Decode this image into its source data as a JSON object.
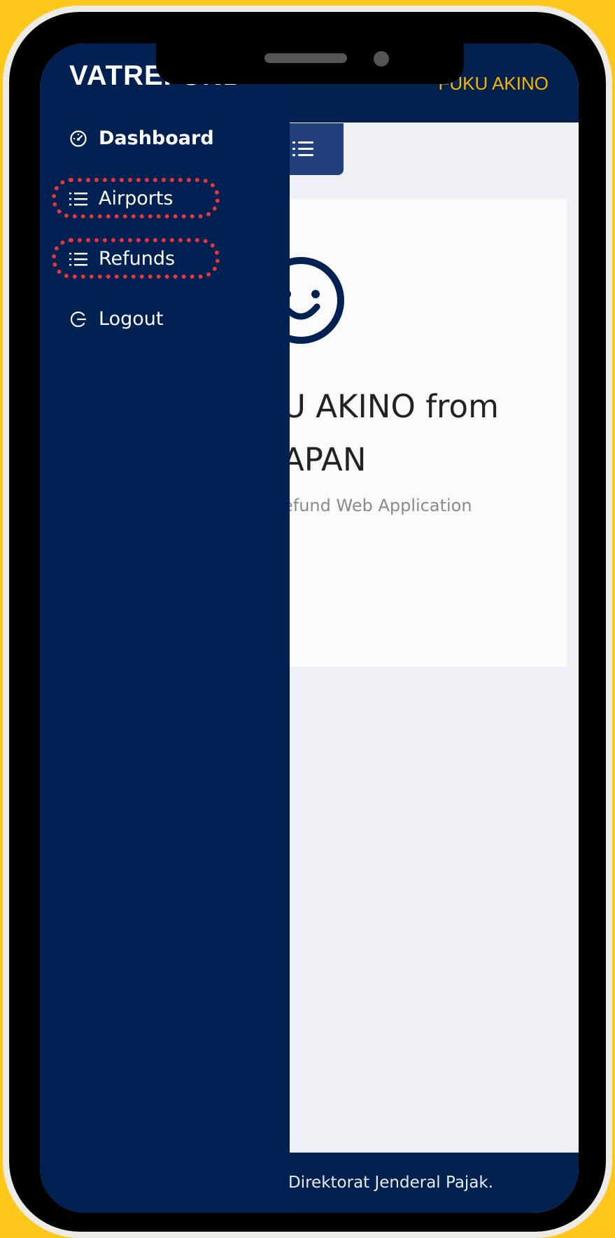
{
  "header": {
    "brand": "VATREFUND",
    "user_name": "FUKU AKINO"
  },
  "sidebar": {
    "items": [
      {
        "label": "Dashboard",
        "icon": "dashboard-gauge-icon"
      },
      {
        "label": "Airports",
        "icon": "list-icon"
      },
      {
        "label": "Refunds",
        "icon": "list-icon"
      },
      {
        "label": "Logout",
        "icon": "logout-icon"
      }
    ]
  },
  "main": {
    "welcome_line1": "U AKINO from",
    "welcome_line2": "APAN",
    "welcome_subtitle": "efund Web Application",
    "menu_toggle_icon": "list-icon"
  },
  "footer": {
    "text": "Direktorat Jenderal Pajak."
  },
  "colors": {
    "background": "#FFC61C",
    "navy": "#012153",
    "accent": "#F7B500",
    "highlight": "#E8353A"
  }
}
